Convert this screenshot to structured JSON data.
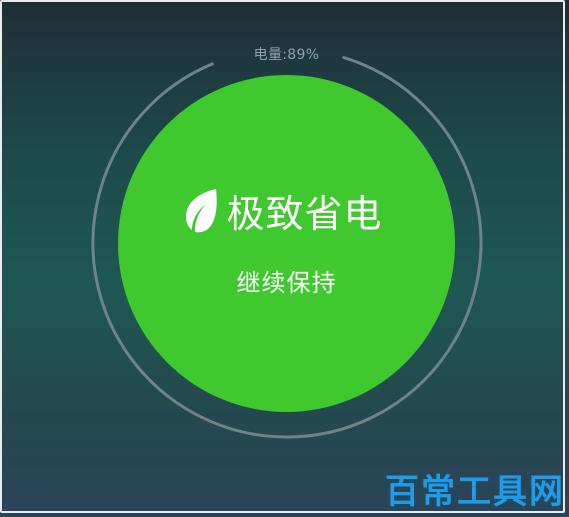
{
  "battery": {
    "label": "电量:89%",
    "level_percent": 89
  },
  "mode": {
    "title": "极致省电",
    "action_label": "继续保持",
    "icon": "leaf-icon"
  },
  "watermark": {
    "text": "百常工具网"
  },
  "colors": {
    "circle": "#40c82f",
    "ring": "#6f8488",
    "text": "#ffffff",
    "battery_label": "#8fa3ab",
    "watermark": "#1da1f2"
  }
}
